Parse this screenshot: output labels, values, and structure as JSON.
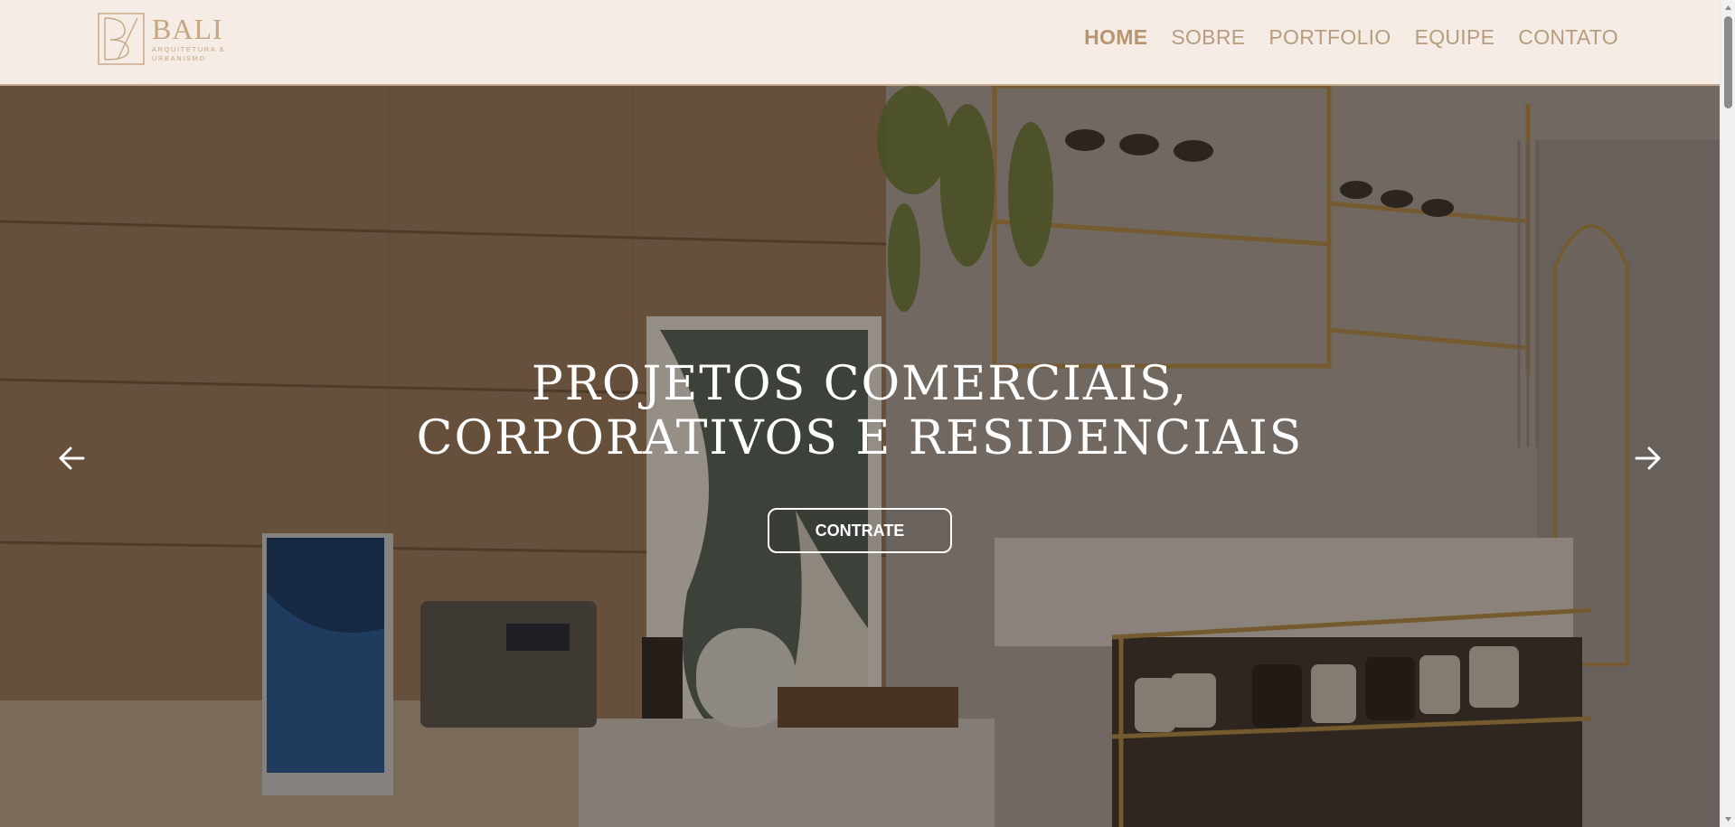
{
  "brand": {
    "name": "BALI",
    "subtitle_line1": "ARQUITETURA &",
    "subtitle_line2": "URBANISMO",
    "color": "#c5a582"
  },
  "nav": {
    "items": [
      {
        "label": "HOME",
        "active": true
      },
      {
        "label": "SOBRE",
        "active": false
      },
      {
        "label": "PORTFOLIO",
        "active": false
      },
      {
        "label": "EQUIPE",
        "active": false
      },
      {
        "label": "CONTATO",
        "active": false
      }
    ]
  },
  "hero": {
    "title_line1": "PROJETOS COMERCIAIS,",
    "title_line2": "CORPORATIVOS E RESIDENCIAIS",
    "cta_label": "CONTRATE",
    "prev_icon": "arrow-left-icon",
    "next_icon": "arrow-right-icon"
  },
  "colors": {
    "header_bg": "#f5ede5",
    "accent": "#b89470",
    "text_on_hero": "#ffffff"
  }
}
